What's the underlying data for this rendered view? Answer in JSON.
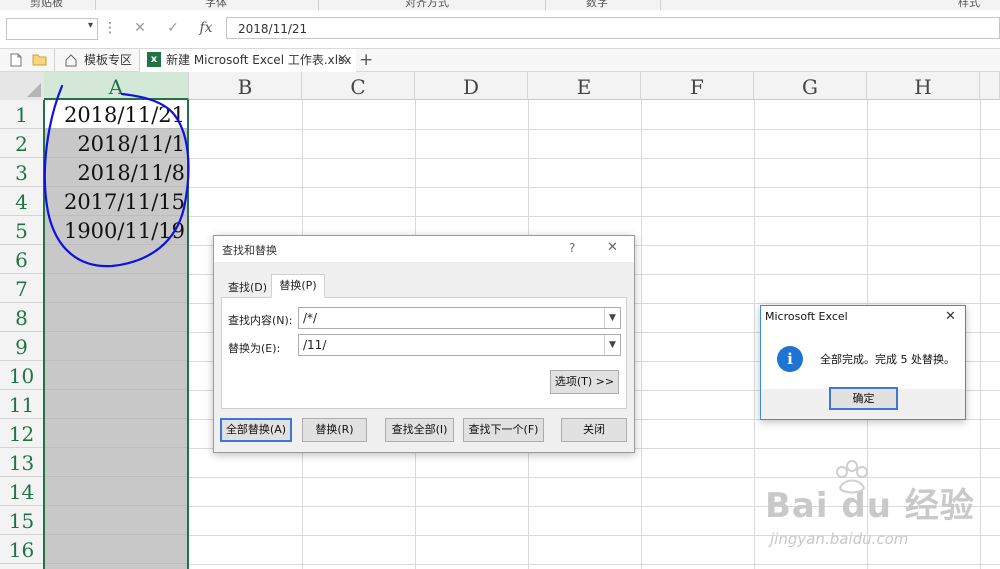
{
  "ribbon": {
    "groups": [
      "剪贴板",
      "字体",
      "对齐方式",
      "数字",
      "样式"
    ]
  },
  "formula_bar": {
    "cancel_glyph": "✕",
    "enter_glyph": "✓",
    "fx_label": "fx",
    "value": "2018/11/21"
  },
  "tabs": {
    "template_label": "模板专区",
    "file_label": "新建 Microsoft Excel 工作表.xlsx",
    "close_glyph": "✕",
    "add_glyph": "+"
  },
  "grid": {
    "columns": [
      "A",
      "B",
      "C",
      "D",
      "E",
      "F",
      "G",
      "H"
    ],
    "rows": [
      "1",
      "2",
      "3",
      "4",
      "5",
      "6",
      "7",
      "8",
      "9",
      "10",
      "11",
      "12",
      "13",
      "14",
      "15",
      "16"
    ],
    "column_a_values": [
      "2018/11/21",
      "2018/11/1",
      "2018/11/8",
      "2017/11/15",
      "1900/11/19"
    ]
  },
  "find_replace_dialog": {
    "title": "查找和替换",
    "help_glyph": "?",
    "close_glyph": "✕",
    "tab_find": "查找(D)",
    "tab_replace": "替换(P)",
    "find_label": "查找内容(N):",
    "find_value": "/*/",
    "replace_label": "替换为(E):",
    "replace_value": "/11/",
    "options_button": "选项(T) >>",
    "replace_all_button": "全部替换(A)",
    "replace_button": "替换(R)",
    "find_all_button": "查找全部(I)",
    "find_next_button": "查找下一个(F)",
    "close_button": "关闭"
  },
  "message_box": {
    "title": "Microsoft Excel",
    "close_glyph": "✕",
    "icon_glyph": "i",
    "message": "全部完成。完成 5 处替换。",
    "ok_button": "确定"
  },
  "watermark": {
    "brand": "Bai du 经验",
    "url": "jingyan.baidu.com"
  },
  "colors": {
    "excel_green": "#217346",
    "selection_gray": "#c8c8c8",
    "annotation_blue": "#1010e0",
    "info_blue": "#1e74d0"
  }
}
